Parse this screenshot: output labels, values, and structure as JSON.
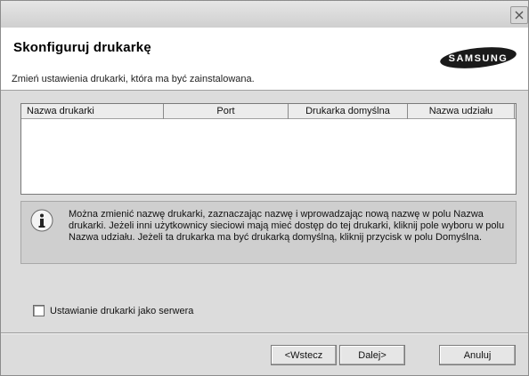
{
  "window": {
    "close_icon": "close-icon"
  },
  "header": {
    "title": "Skonfiguruj drukarkę",
    "subtitle": "Zmień ustawienia drukarki, która ma być zainstalowana.",
    "logo_text": "SAMSUNG"
  },
  "list": {
    "columns": [
      "Nazwa drukarki",
      "Port",
      "Drukarka domyślna",
      "Nazwa udziału"
    ],
    "rows": []
  },
  "info": {
    "icon": "info-icon",
    "text": "Można zmienić nazwę drukarki, zaznaczając nazwę i wprowadzając nową nazwę w polu Nazwa drukarki. Jeżeli inni użytkownicy sieciowi mają mieć dostęp do tej drukarki, kliknij pole wyboru w polu Nazwa udziału. Jeżeli ta drukarka ma być drukarką domyślną, kliknij przycisk w polu Domyślna."
  },
  "options": {
    "server_checkbox_label": "Ustawianie drukarki jako serwera",
    "server_checkbox_checked": false
  },
  "buttons": {
    "back": "<Wstecz",
    "next": "Dalej>",
    "cancel": "Anuluj"
  }
}
